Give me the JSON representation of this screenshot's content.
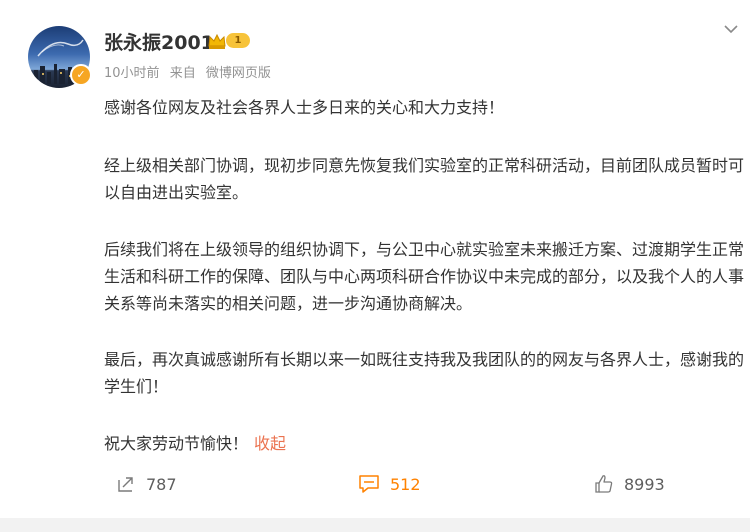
{
  "post": {
    "author": "张永振2001",
    "level_badge": "1",
    "time": "10小时前",
    "source_prefix": "来自",
    "source": "微博网页版",
    "paragraphs": [
      "感谢各位网友及社会各界人士多日来的关心和大力支持！",
      "经上级相关部门协调，现初步同意先恢复我们实验室的正常科研活动，目前团队成员暂时可以自由进出实验室。",
      "后续我们将在上级领导的组织协调下，与公卫中心就实验室未来搬迁方案、过渡期学生正常生活和科研工作的保障、团队与中心两项科研合作协议中未完成的部分，以及我个人的人事关系等尚未落实的相关问题，进一步沟通协商解决。",
      "最后，再次真诚感谢所有长期以来一如既往支持我及我团队的的网友与各界人士，感谢我的学生们！",
      "祝大家劳动节愉快！"
    ],
    "collapse_label": "收起"
  },
  "actions": {
    "repost_count": "787",
    "comment_count": "512",
    "like_count": "8993"
  },
  "colors": {
    "accent": "#ff8200",
    "link": "#eb7350",
    "meta": "#939393"
  },
  "icons": {
    "repost": "repost-icon",
    "comment": "comment-icon",
    "like": "thumbs-up-icon",
    "more": "chevron-down-icon",
    "vip": "crown-icon",
    "verified": "verified-icon"
  }
}
